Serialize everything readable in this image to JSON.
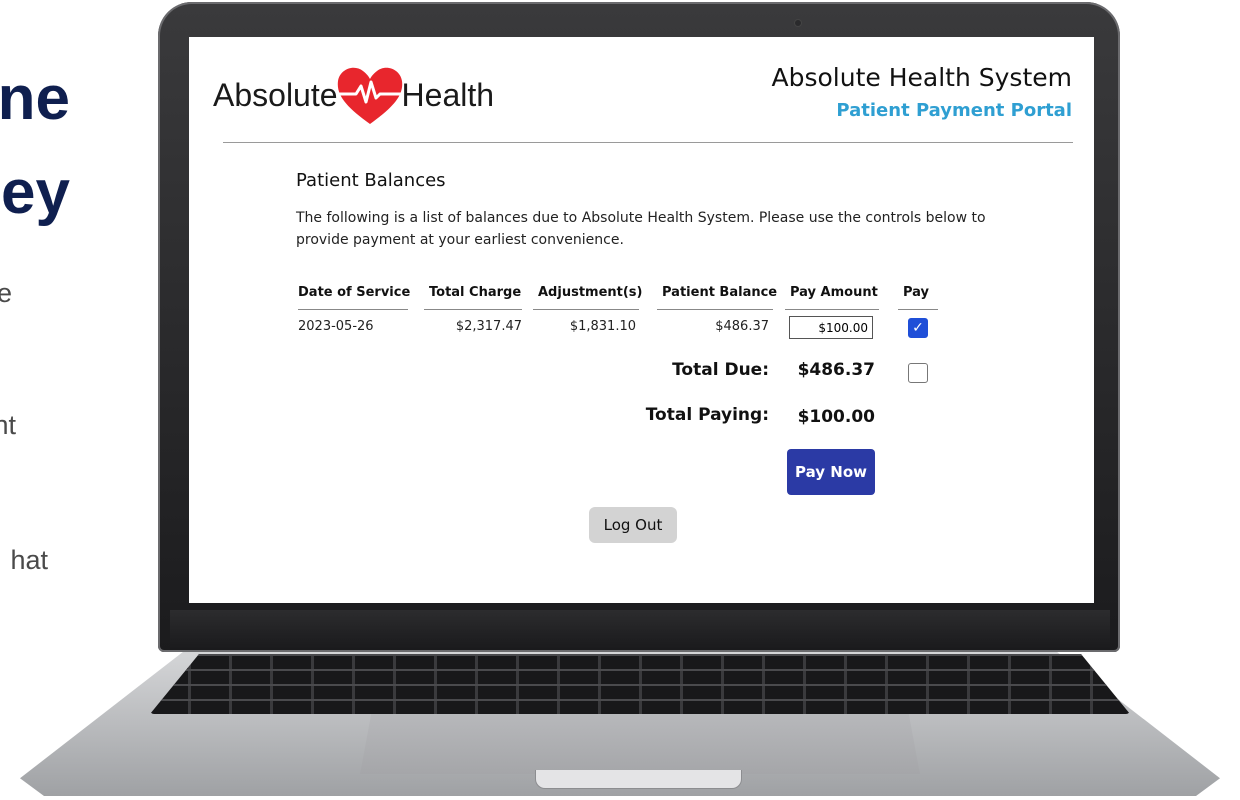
{
  "side_text": {
    "heading_line1": "ne",
    "heading_line2": "ey",
    "line1": "e",
    "line2": "nt",
    "line3": "hat"
  },
  "header": {
    "logo_left": "Absolute",
    "logo_right": "Health",
    "system_title": "Absolute Health System",
    "portal_title": "Patient Payment Portal",
    "portal_color": "#2f9fd2"
  },
  "section": {
    "title": "Patient Balances",
    "intro": "The following is a list of balances due to Absolute Health System. Please use the controls below to provide payment at your earliest convenience."
  },
  "table": {
    "columns": [
      "Date of Service",
      "Total Charge",
      "Adjustment(s)",
      "Patient Balance",
      "Pay Amount",
      "Pay"
    ],
    "rows": [
      {
        "date_of_service": "2023-05-26",
        "total_charge": "$2,317.47",
        "adjustments": "$1,831.10",
        "patient_balance": "$486.37",
        "pay_amount": "$100.00",
        "pay_checked": true
      }
    ]
  },
  "totals": {
    "total_due_label": "Total Due:",
    "total_due_value": "$486.37",
    "total_due_checked": false,
    "total_paying_label": "Total Paying:",
    "total_paying_value": "$100.00"
  },
  "buttons": {
    "pay_now": "Pay Now",
    "log_out": "Log Out",
    "pay_now_color": "#2b3aa5",
    "checkbox_color": "#1f4fd8"
  },
  "icons": {
    "logo": "heart-ekg-icon",
    "checked": "checkmark-icon"
  }
}
